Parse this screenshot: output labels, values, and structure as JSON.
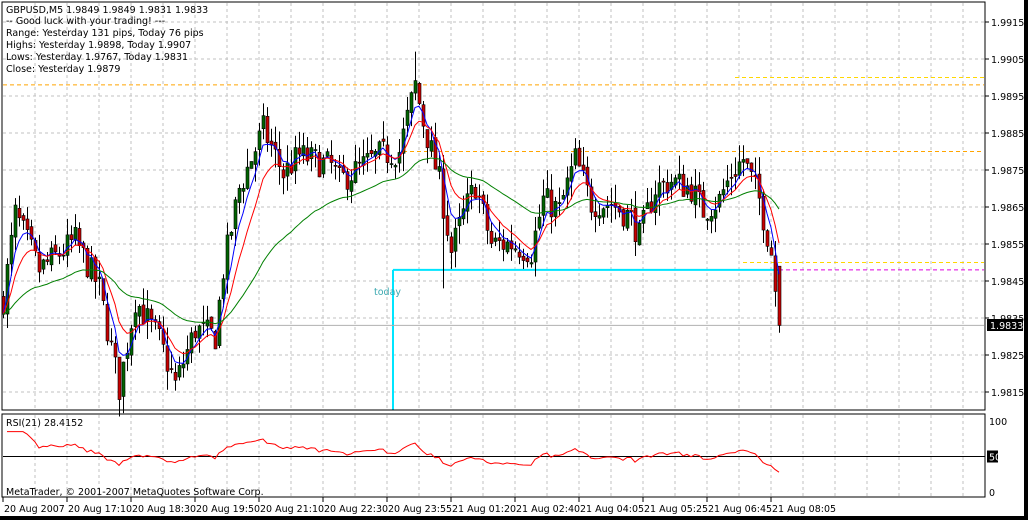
{
  "header": {
    "symbol_line": "GBPUSD,M5  1.9849 1.9849 1.9831 1.9833",
    "comment_lines": [
      "-- Good luck with your trading! ---",
      "Range: Yesterday 131 pips, Today 76 pips",
      "Highs: Yesterday 1.9898, Today 1.9907",
      "Lows:  Yesterday 1.9767, Today 1.9831",
      "Close: Yesterday 1.9879"
    ]
  },
  "today_label": "today",
  "copyright": "MetaTrader, © 2001-2007 MetaQuotes Software Corp.",
  "rsi": {
    "label": "RSI(21) 28.4152",
    "period": 21,
    "levels": [
      "100",
      "50",
      "0"
    ]
  },
  "current_price": "1.9833",
  "colors": {
    "bull": "#006400",
    "bear": "#c80000",
    "ma_fast": "#0000ff",
    "ma_mid": "#ff0000",
    "ma_slow": "#008000",
    "rsi": "#ff0000",
    "today": "#00e5ff",
    "orange": "#ffa500",
    "yellow": "#ffd700",
    "magenta": "#e000e0"
  },
  "chart_data": {
    "type": "candlestick",
    "symbol": "GBPUSD",
    "timeframe": "M5",
    "last_bar": {
      "open": 1.9849,
      "high": 1.9849,
      "low": 1.9831,
      "close": 1.9833
    },
    "ylim": [
      1.9808,
      1.9925
    ],
    "y_ticks": [
      "1.9915",
      "1.9905",
      "1.9895",
      "1.9885",
      "1.9875",
      "1.9865",
      "1.9855",
      "1.9845",
      "1.9835",
      "1.9825",
      "1.9815"
    ],
    "x_ticks": [
      "20 Aug 2007",
      "20 Aug 17:10",
      "20 Aug 18:30",
      "20 Aug 19:50",
      "20 Aug 21:10",
      "20 Aug 22:30",
      "20 Aug 23:55",
      "21 Aug 01:20",
      "21 Aug 02:40",
      "21 Aug 04:05",
      "21 Aug 05:25",
      "21 Aug 06:45",
      "21 Aug 08:05"
    ],
    "bars_per_x_tick": 16,
    "bar_count": 195,
    "close_path": [
      [
        0,
        1.984
      ],
      [
        3,
        1.9863
      ],
      [
        9,
        1.9848
      ],
      [
        18,
        1.9856
      ],
      [
        24,
        1.9843
      ],
      [
        29,
        1.9816
      ],
      [
        33,
        1.984
      ],
      [
        39,
        1.9829
      ],
      [
        43,
        1.9817
      ],
      [
        48,
        1.9832
      ],
      [
        53,
        1.983
      ],
      [
        55,
        1.9848
      ],
      [
        59,
        1.987
      ],
      [
        65,
        1.9886
      ],
      [
        70,
        1.9874
      ],
      [
        74,
        1.9879
      ],
      [
        82,
        1.9876
      ],
      [
        84,
        1.9872
      ],
      [
        94,
        1.9879
      ],
      [
        99,
        1.988
      ],
      [
        103,
        1.9898
      ],
      [
        105,
        1.9888
      ],
      [
        109,
        1.9872
      ],
      [
        112,
        1.9853
      ],
      [
        115,
        1.9863
      ],
      [
        118,
        1.9871
      ],
      [
        122,
        1.9855
      ],
      [
        127,
        1.9855
      ],
      [
        132,
        1.9853
      ],
      [
        135,
        1.9867
      ],
      [
        139,
        1.9864
      ],
      [
        143,
        1.9878
      ],
      [
        147,
        1.9866
      ],
      [
        152,
        1.9866
      ],
      [
        157,
        1.9862
      ],
      [
        159,
        1.9857
      ],
      [
        163,
        1.987
      ],
      [
        167,
        1.9872
      ],
      [
        172,
        1.987
      ],
      [
        175,
        1.9864
      ],
      [
        179,
        1.9867
      ],
      [
        182,
        1.9874
      ],
      [
        185,
        1.9878
      ],
      [
        189,
        1.9867
      ],
      [
        192,
        1.9853
      ],
      [
        194,
        1.9833
      ]
    ],
    "spike_high": {
      "bar": 103,
      "value": 1.9907
    },
    "spike_low": {
      "bar": 110,
      "value": 1.9843
    },
    "moving_averages": [
      {
        "name": "fast",
        "period": 5
      },
      {
        "name": "mid",
        "period": 10
      },
      {
        "name": "slow",
        "period": 40
      }
    ],
    "levels": [
      {
        "name": "yesterday-high",
        "value": 1.9898,
        "color": "orange",
        "from_bar": 0
      },
      {
        "name": "yesterday-close",
        "value": 1.988,
        "color": "orange",
        "from_bar": 100
      },
      {
        "name": "level-1.9900",
        "value": 1.99,
        "color": "yellow",
        "from_bar": 183
      },
      {
        "name": "level-1.9850",
        "value": 1.985,
        "color": "yellow",
        "from_bar": 185
      },
      {
        "name": "today-open",
        "value": 1.9848,
        "color": "magenta",
        "from_bar": 194
      }
    ],
    "today_start_bar": 97,
    "today_open": 1.9848
  }
}
